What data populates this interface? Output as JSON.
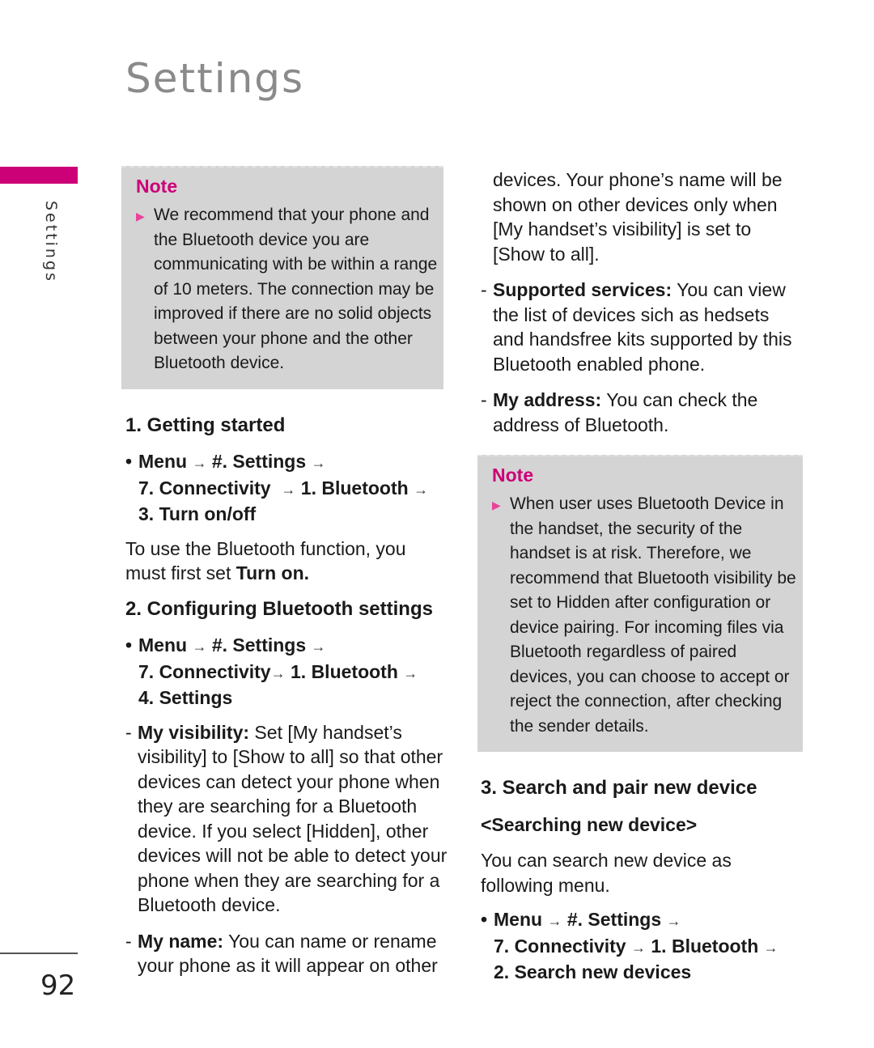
{
  "header": {
    "title": "Settings",
    "side_label": "Settings"
  },
  "footer": {
    "page_number": "92"
  },
  "colors": {
    "accent": "#cc0077",
    "note_bg": "#d4d4d4",
    "bullet": "#e8449a",
    "title": "#8a8a8a"
  },
  "left": {
    "note": {
      "title": "Note",
      "bullet_icon": "triangle-right",
      "text": "We recommend that your phone and the Bluetooth device you are communicating with be within a range of 10 meters. The connection may be improved if there are no solid objects between your phone and the other Bluetooth device."
    },
    "section1": {
      "heading": "1. Getting started",
      "path": [
        "Menu",
        "#. Settings",
        "7. Connectivity",
        "1. Bluetooth",
        "3. Turn on/off"
      ],
      "para_prefix": "To use the Bluetooth function, you must first set ",
      "para_bold": "Turn on."
    },
    "section2": {
      "heading": "2. Configuring Bluetooth settings",
      "path": [
        "Menu",
        "#. Settings",
        "7. Connectivity",
        "1. Bluetooth",
        "4. Settings"
      ],
      "items": [
        {
          "label": "My visibility:",
          "text": " Set [My handset’s visibility] to [Show to all] so that other devices can detect your phone when they are searching for a Bluetooth device. If you select [Hidden], other devices will not be able to detect your phone when they are searching for a Bluetooth device."
        },
        {
          "label": "My name:",
          "text": " You can name or rename your phone as it will appear on other"
        }
      ]
    }
  },
  "right": {
    "continued": "devices. Your phone’s name will be shown on other devices only when [My handset’s visibility] is set to [Show to all].",
    "items": [
      {
        "label": "Supported services:",
        "text": " You can view the list of devices sich as hedsets and handsfree kits supported by this Bluetooth enabled phone."
      },
      {
        "label": "My address:",
        "text": " You can check the address of Bluetooth."
      }
    ],
    "note": {
      "title": "Note",
      "bullet_icon": "triangle-right",
      "text": "When user uses Bluetooth Device in the handset, the security of the handset is at risk. Therefore, we recommend that Bluetooth visibility be set to Hidden after configuration or device pairing. For incoming files via Bluetooth regardless of paired devices, you can choose to accept or reject the connection, after checking the sender details."
    },
    "section3": {
      "heading": "3. Search and pair new device",
      "subheading": "<Searching new device>",
      "para": "You can search new device as following menu.",
      "path": [
        "Menu",
        "#. Settings",
        "7. Connectivity",
        "1. Bluetooth",
        "2. Search new devices"
      ]
    }
  },
  "symbols": {
    "arrow": "→",
    "bullet": "•",
    "dash": "-",
    "triangle": "▶"
  }
}
